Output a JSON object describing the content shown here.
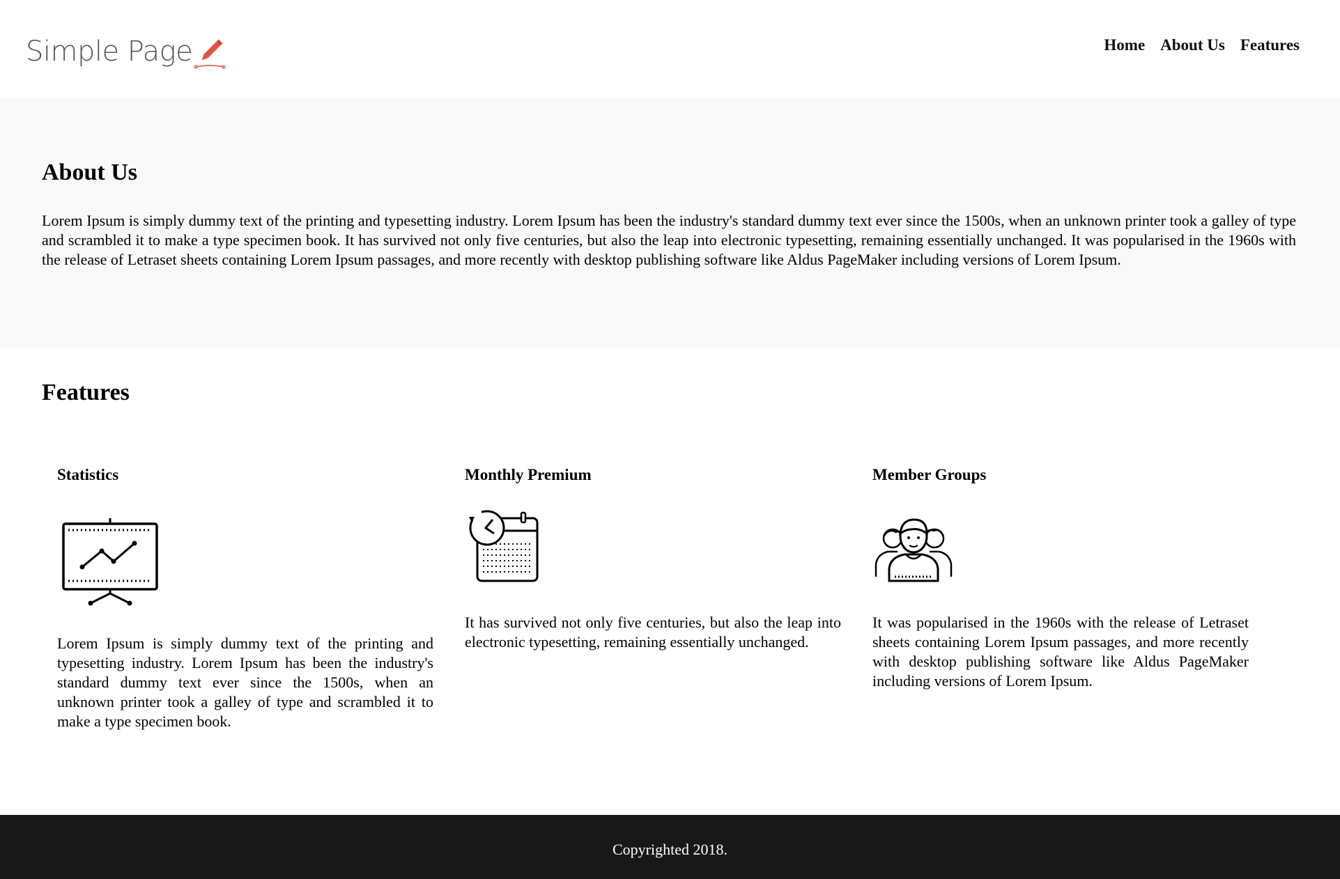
{
  "header": {
    "logo_text": "Simple Page",
    "logo_icon": "pencil-icon",
    "accent": "#e0533f",
    "nav": [
      {
        "label": "Home"
      },
      {
        "label": "About Us"
      },
      {
        "label": "Features"
      }
    ]
  },
  "about": {
    "title": "About Us",
    "text": "Lorem Ipsum is simply dummy text of the printing and typesetting industry. Lorem Ipsum has been the industry's standard dummy text ever since the 1500s, when an unknown printer took a galley of type and scrambled it to make a type specimen book. It has survived not only five centuries, but also the leap into electronic typesetting, remaining essentially unchanged. It was popularised in the 1960s with the release of Letraset sheets containing Lorem Ipsum passages, and more recently with desktop publishing software like Aldus PageMaker including versions of Lorem Ipsum."
  },
  "features": {
    "title": "Features",
    "items": [
      {
        "title": "Statistics",
        "icon": "presentation-chart-icon",
        "text": "Lorem Ipsum is simply dummy text of the printing and typesetting industry. Lorem Ipsum has been the industry's standard dummy text ever since the 1500s, when an unknown printer took a galley of type and scrambled it to make a type specimen book."
      },
      {
        "title": "Monthly Premium",
        "icon": "calendar-clock-icon",
        "text": "It has survived not only five centuries, but also the leap into electronic typesetting, remaining essentially unchanged."
      },
      {
        "title": "Member Groups",
        "icon": "user-group-icon",
        "text": "It was popularised in the 1960s with the release of Letraset sheets containing Lorem Ipsum passages, and more recently with desktop publishing software like Aldus PageMaker including versions of Lorem Ipsum."
      }
    ]
  },
  "footer": {
    "text": "Copyrighted 2018.",
    "background": "#181818"
  }
}
